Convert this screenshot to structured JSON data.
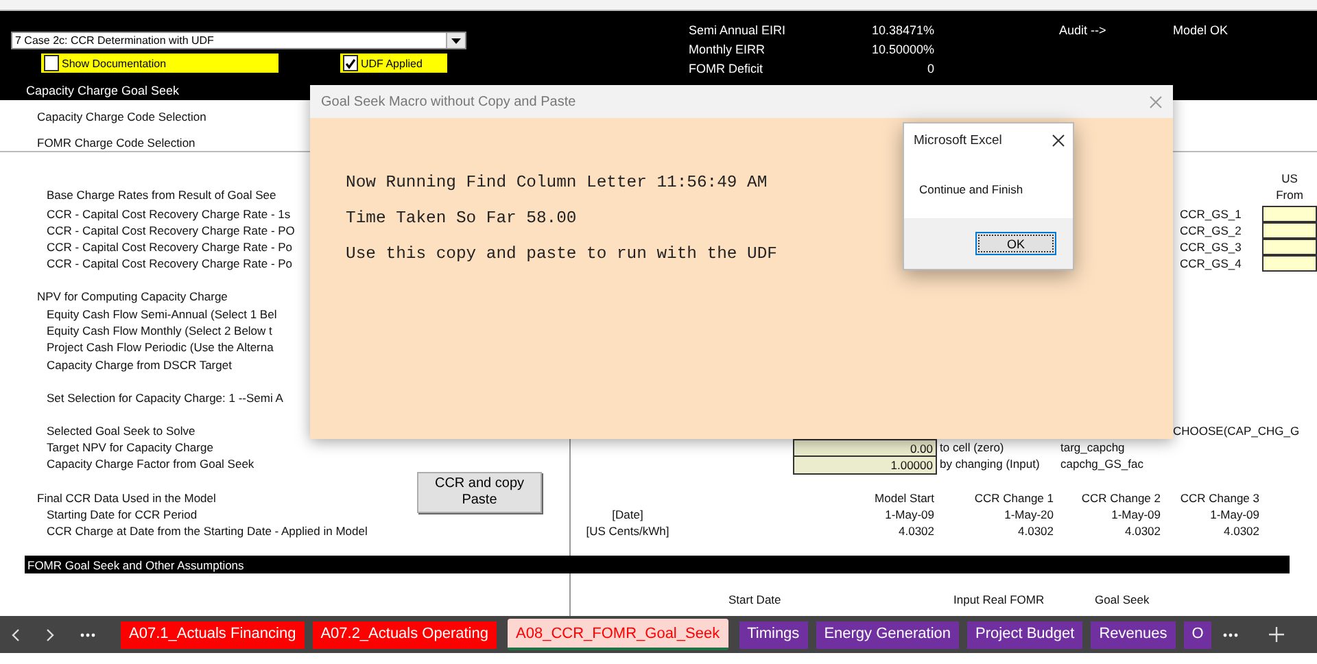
{
  "controls": {
    "case_dropdown": {
      "value": "7 Case 2c: CCR Determination with UDF"
    },
    "checkboxes": [
      {
        "label": "Show Documentation",
        "checked": false
      },
      {
        "label": "UDF Applied",
        "checked": true
      }
    ]
  },
  "summary": [
    {
      "label": "Semi Annual EIRI",
      "value": "10.38471%"
    },
    {
      "label": "Monthly EIRR",
      "value": "10.50000%"
    },
    {
      "label": "FOMR Deficit",
      "value": "0"
    }
  ],
  "audit": {
    "label": "Audit -->",
    "value": "Model OK"
  },
  "section_title": "Capacity Charge Goal Seek",
  "rows": [
    {
      "kind": "heading",
      "cells": [
        {
          "kind": "label",
          "text": "Capacity Charge Code Selection"
        }
      ]
    },
    {
      "kind": "heading",
      "cells": [
        {
          "kind": "label",
          "text": "FOMR Charge Code Selection"
        }
      ]
    },
    {
      "kind": "item",
      "cells": [
        {
          "kind": "header",
          "text": "US"
        }
      ]
    },
    {
      "kind": "item",
      "cells": [
        {
          "kind": "label",
          "text": "Base Charge Rates from Result of Goal See"
        },
        {
          "kind": "header",
          "text": "From"
        }
      ]
    },
    {
      "kind": "item",
      "cells": [
        {
          "kind": "label",
          "text": "CCR - Capital Cost Recovery Charge Rate - 1s"
        },
        {
          "kind": "code",
          "text": "CCR_GS_1"
        },
        {
          "kind": "input_box"
        }
      ]
    },
    {
      "kind": "item",
      "cells": [
        {
          "kind": "label",
          "text": "CCR - Capital Cost Recovery Charge Rate - PO"
        },
        {
          "kind": "code",
          "text": "CCR_GS_2"
        },
        {
          "kind": "input_box"
        }
      ]
    },
    {
      "kind": "item",
      "cells": [
        {
          "kind": "label",
          "text": "CCR - Capital Cost Recovery Charge Rate - Po"
        },
        {
          "kind": "code",
          "text": "CCR_GS_3"
        },
        {
          "kind": "input_box"
        }
      ]
    },
    {
      "kind": "item",
      "cells": [
        {
          "kind": "label",
          "text": "CCR - Capital Cost Recovery Charge Rate - Po"
        },
        {
          "kind": "code",
          "text": "CCR_GS_4"
        },
        {
          "kind": "input_box"
        }
      ]
    },
    {
      "kind": "heading",
      "cells": [
        {
          "kind": "label",
          "text": "NPV for Computing Capacity Charge"
        }
      ]
    },
    {
      "kind": "item",
      "cells": [
        {
          "kind": "label",
          "text": "Equity Cash Flow Semi-Annual (Select 1 Bel"
        }
      ]
    },
    {
      "kind": "item",
      "cells": [
        {
          "kind": "label",
          "text": "Equity Cash Flow Monthly (Select 2 Below t"
        }
      ]
    },
    {
      "kind": "item",
      "cells": [
        {
          "kind": "label",
          "text": "Project Cash Flow Periodic (Use the Alterna"
        }
      ]
    },
    {
      "kind": "item",
      "cells": [
        {
          "kind": "label",
          "text": "Capacity Charge from DSCR Target"
        }
      ]
    },
    {
      "kind": "item",
      "cells": [
        {
          "kind": "label",
          "text": "Set Selection for Capacity Charge: 1 --Semi A"
        }
      ]
    },
    {
      "kind": "item",
      "cells": [
        {
          "kind": "label",
          "text": "Selected Goal Seek to Solve"
        },
        {
          "kind": "formula",
          "text": "CHOOSE(CAP_CHG_G"
        }
      ]
    },
    {
      "kind": "item",
      "cells": [
        {
          "kind": "label",
          "text": "Target NPV for Capacity Charge"
        },
        {
          "kind": "input",
          "text": "0.00"
        },
        {
          "kind": "note",
          "text": "to cell (zero)"
        },
        {
          "kind": "range",
          "text": "targ_capchg"
        }
      ]
    },
    {
      "kind": "item",
      "cells": [
        {
          "kind": "label",
          "text": "Capacity Charge Factor from Goal Seek"
        },
        {
          "kind": "input",
          "text": "1.00000"
        },
        {
          "kind": "note",
          "text": "by changing (Input)"
        },
        {
          "kind": "range",
          "text": "capchg_GS_fac"
        }
      ]
    },
    {
      "kind": "heading",
      "cells": [
        {
          "kind": "label",
          "text": "Final CCR Data Used in the Model"
        },
        {
          "kind": "button",
          "text": "CCR and copy Paste"
        },
        {
          "kind": "model_start",
          "text": "Model Start"
        },
        {
          "kind": "change_1",
          "text": "CCR Change 1"
        },
        {
          "kind": "change_2",
          "text": "CCR Change 2"
        },
        {
          "kind": "change_3",
          "text": "CCR Change 3"
        }
      ]
    },
    {
      "kind": "item",
      "cells": [
        {
          "kind": "label",
          "text": "Starting Date for CCR Period"
        },
        {
          "kind": "unit",
          "text": "[Date]"
        },
        {
          "kind": "model_start",
          "text": "1-May-09"
        },
        {
          "kind": "change_1",
          "text": "1-May-20"
        },
        {
          "kind": "change_2",
          "text": "1-May-09"
        },
        {
          "kind": "change_3",
          "text": "1-May-09"
        }
      ]
    },
    {
      "kind": "item",
      "cells": [
        {
          "kind": "label",
          "text": "CCR Charge at Date from the Starting Date - Applied in Model"
        },
        {
          "kind": "unit",
          "text": "[US Cents/kWh]"
        },
        {
          "kind": "model_start",
          "text": "4.0302"
        },
        {
          "kind": "change_1",
          "text": "4.0302"
        },
        {
          "kind": "change_2",
          "text": "4.0302"
        },
        {
          "kind": "change_3",
          "text": "4.0302"
        }
      ]
    },
    {
      "kind": "band",
      "cells": [
        {
          "kind": "label",
          "text": "FOMR Goal Seek and Other Assumptions"
        }
      ]
    },
    {
      "kind": "item",
      "cells": [
        {
          "kind": "start_date",
          "text": "Start Date"
        },
        {
          "kind": "input_real",
          "text": "Input Real FOMR"
        },
        {
          "kind": "goal_seek",
          "text": "Goal Seek"
        }
      ]
    }
  ],
  "sheet_tabs": [
    {
      "label": "A07.1_Actuals Financing",
      "color": "#ff0000",
      "selected": false
    },
    {
      "label": "A07.2_Actuals Operating",
      "color": "#ff0000",
      "selected": false
    },
    {
      "label": "A08_CCR_FOMR_Goal_Seek",
      "color": "#ff0000",
      "selected": true
    },
    {
      "label": "Timings",
      "color": "#7030a0",
      "selected": false
    },
    {
      "label": "Energy Generation",
      "color": "#7030a0",
      "selected": false
    },
    {
      "label": "Project Budget",
      "color": "#7030a0",
      "selected": false
    },
    {
      "label": "Revenues",
      "color": "#7030a0",
      "selected": false
    },
    {
      "label": "O",
      "color": "#7030a0",
      "selected": false
    }
  ],
  "macro_form": {
    "title": "Goal Seek Macro without Copy and Paste",
    "lines": [
      "Now Running Find Column Letter 11:56:49 AM",
      "Time Taken So Far 58.00",
      "Use this copy and paste to run with the UDF"
    ]
  },
  "message_box": {
    "title": "Microsoft Excel",
    "message": "Continue and Finish",
    "button": "OK"
  }
}
